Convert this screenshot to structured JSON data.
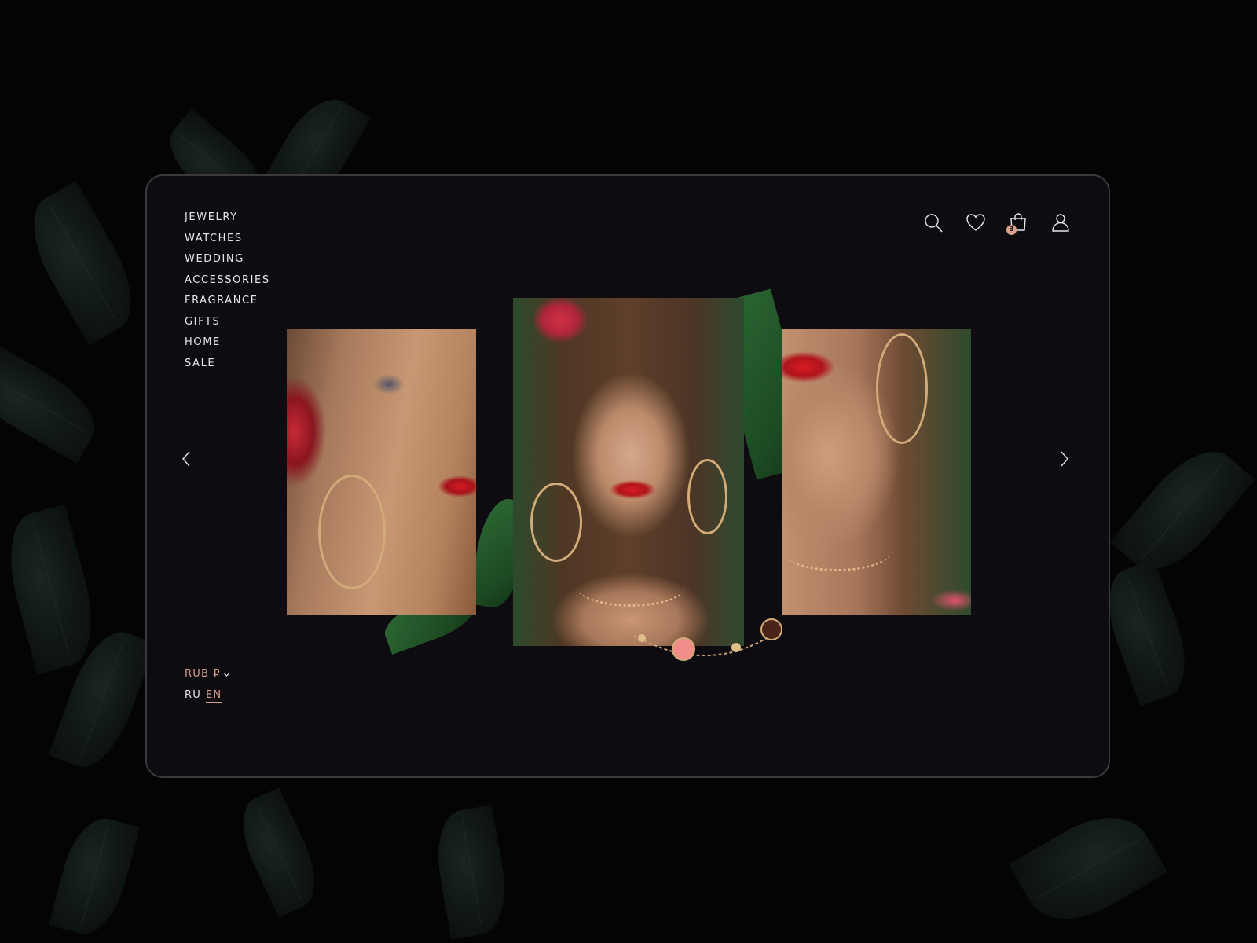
{
  "nav": {
    "items": [
      "JEWELRY",
      "WATCHES",
      "WEDDING",
      "ACCESSORIES",
      "FRAGRANCE",
      "GIFTS",
      "HOME",
      "SALE"
    ]
  },
  "header": {
    "icons": [
      "search-icon",
      "heart-icon",
      "shopping-bag-icon",
      "user-icon"
    ],
    "cart_count": "3"
  },
  "footer": {
    "currency": "RUB ₽",
    "languages": [
      "RU",
      "EN"
    ],
    "active_language": "EN"
  },
  "colors": {
    "accent": "#d9a08b",
    "panel": "#0e0c10",
    "text": "#e9e6ea"
  }
}
